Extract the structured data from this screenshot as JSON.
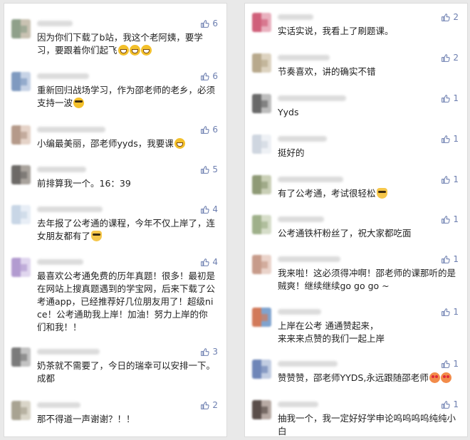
{
  "left_comments": [
    {
      "likes": "6",
      "parts": [
        {
          "t": "text",
          "v": "因为你们下载了b站，我这个老阿姨，要学习，要跟着你们起飞"
        },
        {
          "t": "emoji",
          "v": "grin"
        },
        {
          "t": "emoji",
          "v": "grin"
        },
        {
          "t": "emoji",
          "v": "grin"
        }
      ],
      "avatar": [
        "#8fa08a",
        "#c9c2b2"
      ]
    },
    {
      "likes": "6",
      "parts": [
        {
          "t": "text",
          "v": "重新回归战场学习，作为邵老师的老乡，必须支持一波"
        },
        {
          "t": "emoji",
          "v": "cool"
        }
      ],
      "avatar": [
        "#7f9ac0",
        "#c7d3e6"
      ]
    },
    {
      "likes": "6",
      "parts": [
        {
          "t": "text",
          "v": "小编最美丽，邵老师yyds，我要课"
        },
        {
          "t": "emoji",
          "v": "grin"
        }
      ],
      "avatar": [
        "#b59a8a",
        "#e5d3c8"
      ]
    },
    {
      "likes": "5",
      "parts": [
        {
          "t": "text",
          "v": "前排算我一个。16：39"
        }
      ],
      "avatar": [
        "#6d6a67",
        "#a9a39d"
      ]
    },
    {
      "likes": "4",
      "parts": [
        {
          "t": "text",
          "v": "去年报了公考通的课程，今年不仅上岸了，连女朋友都有了"
        },
        {
          "t": "emoji",
          "v": "cat"
        }
      ],
      "avatar": [
        "#c8d6e6",
        "#e8eef6"
      ]
    },
    {
      "likes": "4",
      "parts": [
        {
          "t": "text",
          "v": "最喜欢公考通免费的历年真题！很多！最初是在网站上搜真题遇到的学宝网，后来下载了公考通app，已经推荐好几位朋友用了！超级nice！公考通助我上岸！加油！努力上岸的你们和我！！"
        }
      ],
      "avatar": [
        "#b29bd0",
        "#e0d6ee"
      ]
    },
    {
      "likes": "3",
      "parts": [
        {
          "t": "text",
          "v": "奶茶就不需要了，今日的瑞幸可以安排一下。成都"
        }
      ],
      "avatar": [
        "#7b7b7b",
        "#c3c3c3"
      ]
    },
    {
      "likes": "2",
      "parts": [
        {
          "t": "text",
          "v": "那不得道一声谢谢？！！"
        }
      ],
      "avatar": [
        "#a8a392",
        "#d9d5c8"
      ]
    }
  ],
  "right_comments": [
    {
      "likes": "2",
      "parts": [
        {
          "t": "text",
          "v": "实话实说，我看上了刷题课。"
        }
      ],
      "avatar": [
        "#d0607a",
        "#e9b1bf"
      ]
    },
    {
      "likes": "2",
      "parts": [
        {
          "t": "text",
          "v": "节奏喜欢，讲的确实不错"
        }
      ],
      "avatar": [
        "#b8a98c",
        "#ddd3c0"
      ]
    },
    {
      "likes": "1",
      "parts": [
        {
          "t": "text",
          "v": "Yyds"
        }
      ],
      "avatar": [
        "#6a6a6a",
        "#bdbdbd"
      ]
    },
    {
      "likes": "1",
      "parts": [
        {
          "t": "text",
          "v": "挺好的"
        }
      ],
      "avatar": [
        "#cfd6e0",
        "#eef1f5"
      ]
    },
    {
      "likes": "1",
      "parts": [
        {
          "t": "text",
          "v": "有了公考通，考试很轻松"
        },
        {
          "t": "emoji",
          "v": "cat"
        }
      ],
      "avatar": [
        "#8f9a76",
        "#c9cfb6"
      ]
    },
    {
      "likes": "1",
      "parts": [
        {
          "t": "text",
          "v": "公考通铁杆粉丝了，祝大家都吃面"
        }
      ],
      "avatar": [
        "#9fb08a",
        "#d6ddc9"
      ]
    },
    {
      "likes": "1",
      "parts": [
        {
          "t": "text",
          "v": "我来啦！这必须得冲啊！邵老师的课那听的是贼爽！继续继续go go go ~"
        }
      ],
      "avatar": [
        "#c79b8a",
        "#ead3ca"
      ]
    },
    {
      "likes": "1",
      "parts": [
        {
          "t": "text",
          "v": "上岸在公考 通通赞起来，\n来来来点赞的我们一起上岸"
        }
      ],
      "avatar": [
        "#d27a5a",
        "#7fa3cf"
      ]
    },
    {
      "likes": "1",
      "parts": [
        {
          "t": "text",
          "v": "赞赞赞，邵老师YYDS,永远跟随邵老师"
        },
        {
          "t": "emoji",
          "v": "heart"
        },
        {
          "t": "emoji",
          "v": "heart"
        }
      ],
      "avatar": [
        "#6f86b8",
        "#c2cde2"
      ]
    },
    {
      "likes": "1",
      "parts": [
        {
          "t": "text",
          "v": "抽我一个，我一定好好学申论呜呜呜呜纯纯小白"
        }
      ],
      "avatar": [
        "#5a4e4a",
        "#b7aaa4"
      ]
    }
  ],
  "colors": {
    "like": "#6d7fb0",
    "text": "#1f1f1f",
    "emoji": "#f3c02b"
  }
}
